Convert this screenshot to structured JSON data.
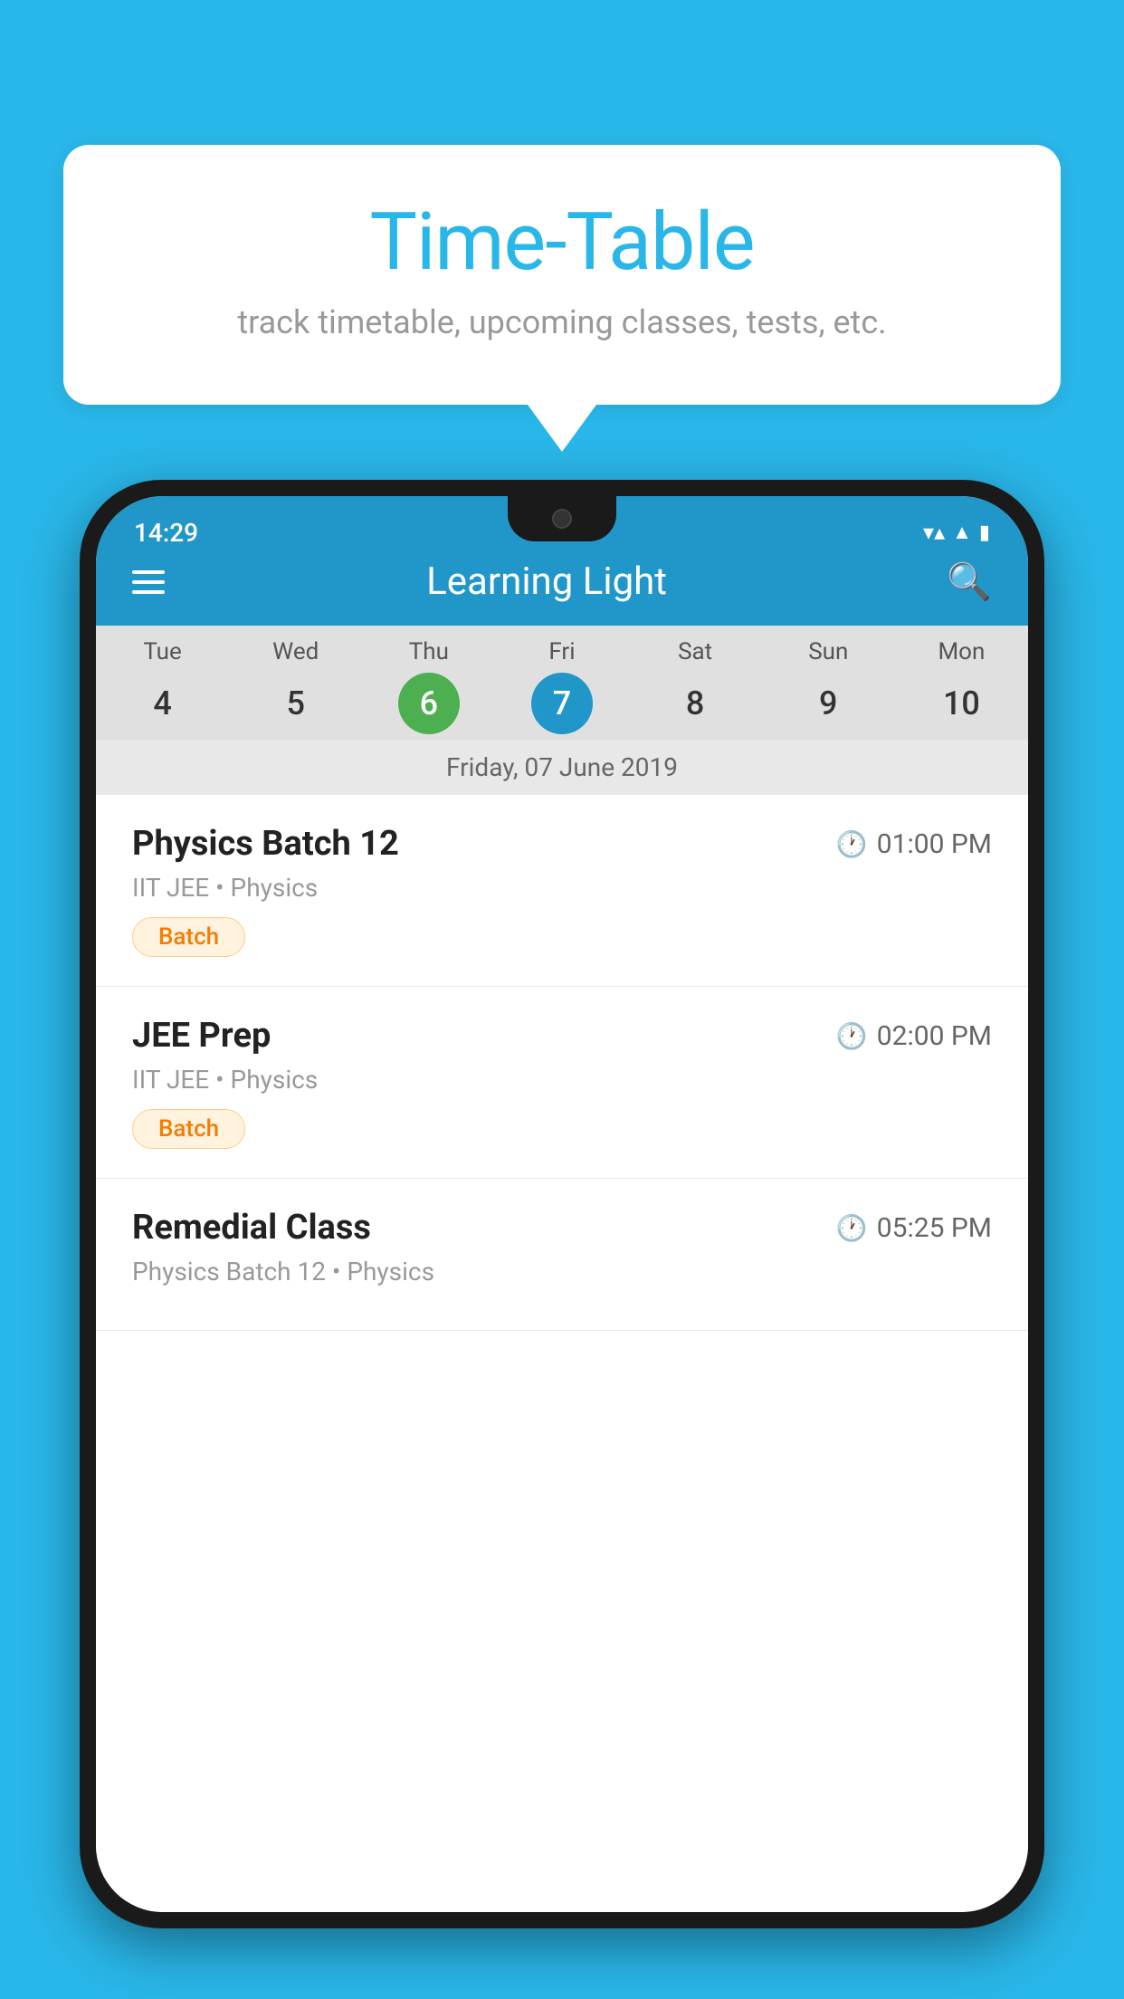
{
  "background_color": "#29B6E8",
  "speech_bubble": {
    "title": "Time-Table",
    "subtitle": "track timetable, upcoming classes, tests, etc."
  },
  "phone": {
    "status_bar": {
      "time": "14:29"
    },
    "app_header": {
      "title": "Learning Light"
    },
    "calendar": {
      "days": [
        {
          "name": "Tue",
          "number": "4",
          "state": "normal"
        },
        {
          "name": "Wed",
          "number": "5",
          "state": "normal"
        },
        {
          "name": "Thu",
          "number": "6",
          "state": "today"
        },
        {
          "name": "Fri",
          "number": "7",
          "state": "selected"
        },
        {
          "name": "Sat",
          "number": "8",
          "state": "normal"
        },
        {
          "name": "Sun",
          "number": "9",
          "state": "normal"
        },
        {
          "name": "Mon",
          "number": "10",
          "state": "normal"
        }
      ],
      "selected_date_label": "Friday, 07 June 2019"
    },
    "schedule": [
      {
        "name": "Physics Batch 12",
        "time": "01:00 PM",
        "meta": "IIT JEE • Physics",
        "tag": "Batch"
      },
      {
        "name": "JEE Prep",
        "time": "02:00 PM",
        "meta": "IIT JEE • Physics",
        "tag": "Batch"
      },
      {
        "name": "Remedial Class",
        "time": "05:25 PM",
        "meta": "Physics Batch 12 • Physics",
        "tag": null
      }
    ]
  }
}
